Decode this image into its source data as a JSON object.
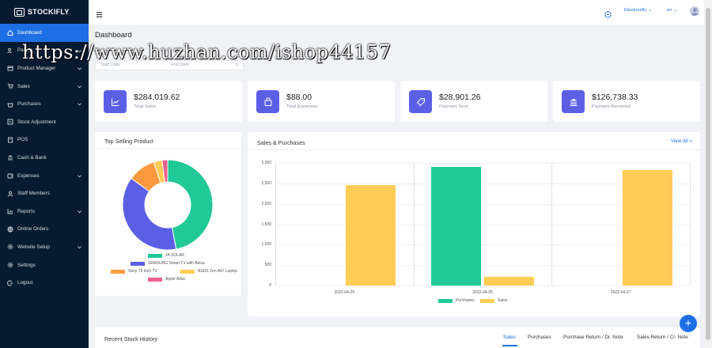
{
  "app": {
    "name": "STOCKIFLY"
  },
  "sidebar": {
    "items": [
      {
        "label": "Dashboard",
        "icon": "home-icon",
        "active": true,
        "submenu": false
      },
      {
        "label": "Parties",
        "icon": "users-icon",
        "active": false,
        "submenu": true
      },
      {
        "label": "Product Manager",
        "icon": "box-icon",
        "active": false,
        "submenu": true
      },
      {
        "label": "Sales",
        "icon": "cart-icon",
        "active": false,
        "submenu": true
      },
      {
        "label": "Purchases",
        "icon": "basket-icon",
        "active": false,
        "submenu": true
      },
      {
        "label": "Stock Adjustment",
        "icon": "adjust-icon",
        "active": false,
        "submenu": false
      },
      {
        "label": "POS",
        "icon": "pos-icon",
        "active": false,
        "submenu": false
      },
      {
        "label": "Cash & Bank",
        "icon": "bank-icon",
        "active": false,
        "submenu": false
      },
      {
        "label": "Expenses",
        "icon": "wallet-icon",
        "active": false,
        "submenu": true
      },
      {
        "label": "Staff Members",
        "icon": "user-icon",
        "active": false,
        "submenu": false
      },
      {
        "label": "Reports",
        "icon": "chart-icon",
        "active": false,
        "submenu": true
      },
      {
        "label": "Online Orders",
        "icon": "globe-icon",
        "active": false,
        "submenu": false
      },
      {
        "label": "Website Setup",
        "icon": "settings-icon",
        "active": false,
        "submenu": true
      },
      {
        "label": "Settings",
        "icon": "gear-icon",
        "active": false,
        "submenu": false
      },
      {
        "label": "Logout",
        "icon": "logout-icon",
        "active": false,
        "submenu": false
      }
    ]
  },
  "topbar": {
    "company": "Electronifly",
    "language": "en"
  },
  "page": {
    "title": "Dashboard"
  },
  "date_range": {
    "start_placeholder": "Start Date",
    "end_placeholder": "End Date"
  },
  "stats": [
    {
      "value": "$284,019.62",
      "label": "Total Sales",
      "icon": "trend-chart-icon"
    },
    {
      "value": "$88.00",
      "label": "Total Expenses",
      "icon": "bag-icon"
    },
    {
      "value": "$28,901.26",
      "label": "Payment Sent",
      "icon": "tag-icon"
    },
    {
      "value": "$126,738.33",
      "label": "Payment Received",
      "icon": "bank-icon"
    }
  ],
  "top_selling": {
    "title": "Top Selling Product"
  },
  "sales_purchases": {
    "title": "Sales & Purchases",
    "view_all": "View All"
  },
  "chart_data": [
    {
      "type": "pie",
      "title": "Top Selling Product",
      "donut": true,
      "legend_placement": "bottom",
      "labels": [
        "JA SOLAR",
        "SAMSUNG Smart TV with Alexa",
        "Sony 75 Inch TV",
        "ASUS Zen AiO Laptop",
        "Apple Atlas"
      ],
      "values": [
        47,
        38,
        10,
        3,
        2
      ],
      "colors": [
        "#20c997",
        "#5b5fe6",
        "#fd9a40",
        "#ffcd56",
        "#ef5f8f"
      ]
    },
    {
      "type": "bar",
      "title": "Sales & Purchases",
      "legend_placement": "bottom",
      "categories": [
        "2022-04-25",
        "2022-04-26",
        "2022-04-27"
      ],
      "ylim": [
        0,
        3000
      ],
      "yticks": [
        "0",
        "500",
        "1,000",
        "1,500",
        "2,000",
        "2,500",
        "3,000"
      ],
      "grid": true,
      "series": [
        {
          "name": "Purchases",
          "color": "#20c997",
          "values": [
            0,
            2900,
            0
          ]
        },
        {
          "name": "Sales",
          "color": "#ffcd56",
          "values": [
            2460,
            220,
            2830
          ]
        }
      ]
    }
  ],
  "recent_stock": {
    "title": "Recent Stock History",
    "tabs": [
      "Sales",
      "Purchases",
      "Purchase Return / Dr. Note",
      "Sales Return / Cr. Note"
    ]
  },
  "fab": {
    "label": "+"
  },
  "watermark": {
    "text": "https://www.huzhan.com/ishop44157"
  }
}
